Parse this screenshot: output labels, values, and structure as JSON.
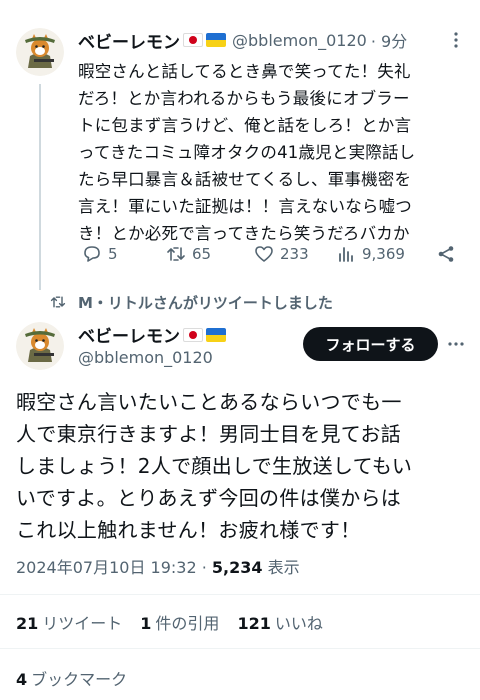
{
  "tweet1": {
    "name": "ベビーレモン",
    "handle": "@bblemon_0120",
    "time": "· 9分",
    "lines": [
      "暇空さんと話してるとき鼻で笑ってた！失礼",
      "だろ！とか言われるからもう最後にオブラー",
      "トに包まず言うけど、俺と話をしろ！とか言",
      "ってきたコミュ障オタクの41歳児と実際話し",
      "たら早口暴言＆話被せてくるし、軍事機密を",
      "言え！軍にいた証拠は！！言えないなら嘘つ",
      "き！とか必死で言ってきたら笑うだろバカか"
    ],
    "replies": "5",
    "retweets": "65",
    "likes": "233",
    "views": "9,369"
  },
  "retweet_notice": "M・リトルさんがリツイートしました",
  "tweet2": {
    "name": "ベビーレモン",
    "handle": "@bblemon_0120",
    "follow_label": "フォローする",
    "lines": [
      "暇空さん言いたいことあるならいつでも一",
      "人で東京行きますよ！男同士目を見てお話",
      "しましょう！2人で顔出しで生放送してもい",
      "いですよ。とりあえず今回の件は僕からは",
      "これ以上触れません！お疲れ様です！"
    ],
    "datetime": "2024年07月10日 19:32 · ",
    "view_count": "5,234",
    "view_label": " 表示",
    "retweet_count": "21",
    "retweet_label": "リツイート",
    "quote_count": "1",
    "quote_label": "件の引用",
    "like_count": "121",
    "like_label": "いいね",
    "bookmark_count": "4",
    "bookmark_label": "ブックマーク"
  },
  "icons": {
    "flags": [
      "japan-flag",
      "ukraine-flag"
    ],
    "actions": [
      "reply-icon",
      "retweet-icon",
      "like-icon",
      "views-icon",
      "share-icon"
    ],
    "more": "more-icon"
  },
  "colors": {
    "text": "#0f1419",
    "secondary": "#536471",
    "follow_button": "#0f1419"
  }
}
